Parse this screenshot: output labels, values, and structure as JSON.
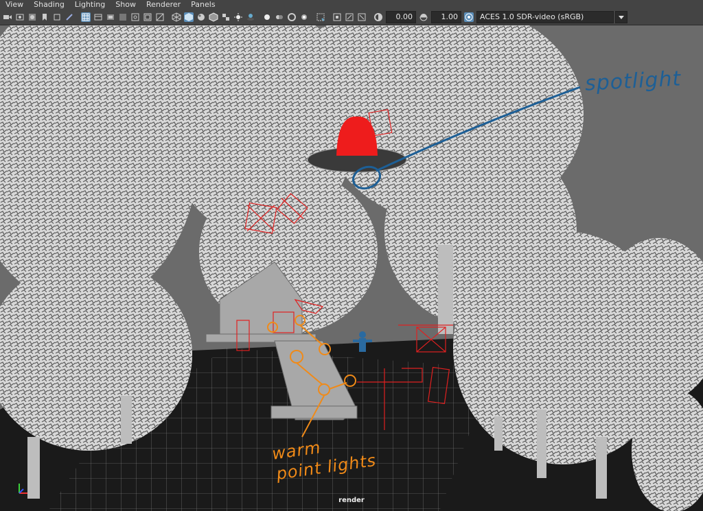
{
  "menubar": {
    "items": [
      "View",
      "Shading",
      "Lighting",
      "Show",
      "Renderer",
      "Panels"
    ]
  },
  "toolbar": {
    "exposure_value": "0.00",
    "gamma_value": "1.00",
    "color_space": "ACES 1.0 SDR-video (sRGB)",
    "icons": [
      "camera-icon",
      "bookmark-icon",
      "grid-icon",
      "wireframe-icon",
      "shaded-icon",
      "lights-icon",
      "shadows-icon",
      "isolate-icon",
      "xray-icon",
      "exposure-icon",
      "gamma-icon",
      "color-management-icon"
    ]
  },
  "viewport": {
    "camera_label": "render",
    "annotations": {
      "spotlight": "spotlight",
      "warm_line1": "warm",
      "warm_line2": "point lights"
    }
  },
  "colors": {
    "accent_blue": "#1d5f96",
    "annotation_orange": "#f08a18",
    "light_red": "#e02020",
    "toolbar_active": "#5a8db8"
  }
}
